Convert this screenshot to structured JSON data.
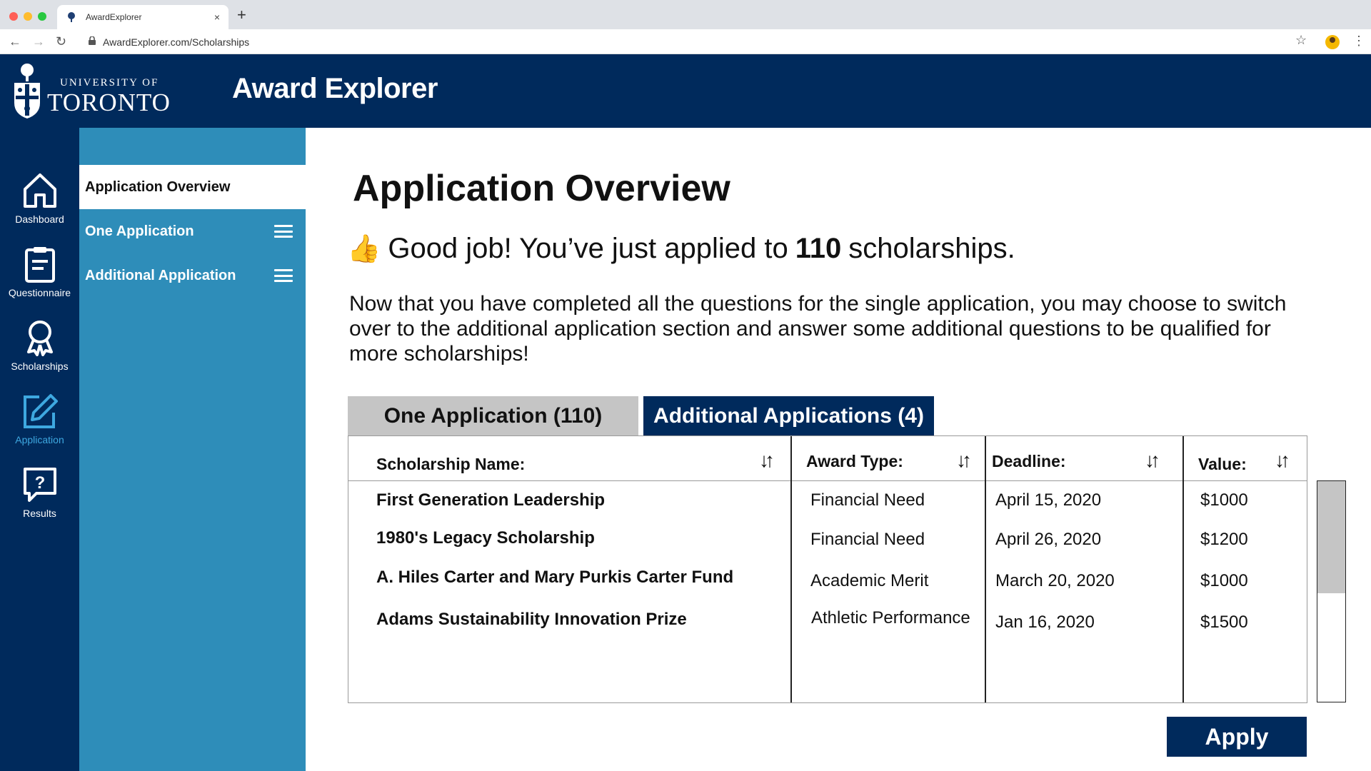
{
  "browser": {
    "tab_title": "AwardExplorer",
    "url": "AwardExplorer.com/Scholarships",
    "close_glyph": "×",
    "newtab_glyph": "+",
    "back_glyph": "←",
    "forward_glyph": "→",
    "reload_glyph": "↻",
    "star_glyph": "☆",
    "menu_glyph": "⋮"
  },
  "header": {
    "university_line1": "UNIVERSITY OF",
    "university_line2": "TORONTO",
    "brand": "Award Explorer"
  },
  "rail": [
    {
      "label": "Dashboard",
      "icon": "home-icon"
    },
    {
      "label": "Questionnaire",
      "icon": "clipboard-icon"
    },
    {
      "label": "Scholarships",
      "icon": "award-ribbon-icon"
    },
    {
      "label": "Application",
      "icon": "edit-icon",
      "active": true
    },
    {
      "label": "Results",
      "icon": "question-bubble-icon"
    }
  ],
  "submenu": {
    "items": [
      {
        "label": "Application Overview",
        "active": true
      },
      {
        "label": "One Application",
        "icon": "hamburger-icon"
      },
      {
        "label": "Additional Application",
        "icon": "hamburger-icon"
      }
    ]
  },
  "main": {
    "title": "Application Overview",
    "goodjob_emoji": "👍",
    "goodjob_prefix": "Good job! You’ve just applied to",
    "goodjob_count": "110",
    "goodjob_suffix": "scholarships.",
    "paragraph": "Now that you have completed all the questions for the single application, you may choose to switch over to the additional application section and answer some additional questions to be qualified for more scholarships!",
    "tabs": [
      {
        "label": "One Application (110)",
        "active": false
      },
      {
        "label": "Additional Applications (4)",
        "active": true
      }
    ],
    "table": {
      "columns": [
        "Scholarship Name:",
        "Award Type:",
        "Deadline:",
        "Value:"
      ],
      "sort_glyph": "↓↑",
      "rows": [
        {
          "name": "First Generation Leadership",
          "type": "Financial Need",
          "deadline": "April 15, 2020",
          "value": "$1000"
        },
        {
          "name": "1980's Legacy Scholarship",
          "type": "Financial Need",
          "deadline": "April 26, 2020",
          "value": "$1200"
        },
        {
          "name": "A. Hiles Carter and Mary Purkis Carter Fund",
          "type": "Academic Merit",
          "deadline": "March 20, 2020",
          "value": "$1000"
        },
        {
          "name": "Adams Sustainability Innovation Prize",
          "type": "Athletic Performance",
          "deadline": "Jan 16, 2020",
          "value": "$1500"
        }
      ]
    },
    "apply_label": "Apply"
  },
  "colors": {
    "navy": "#002a5c",
    "submenu_blue": "#2e8db9",
    "active_rail": "#3ea8e0",
    "inactive_tab": "#c5c5c5"
  }
}
